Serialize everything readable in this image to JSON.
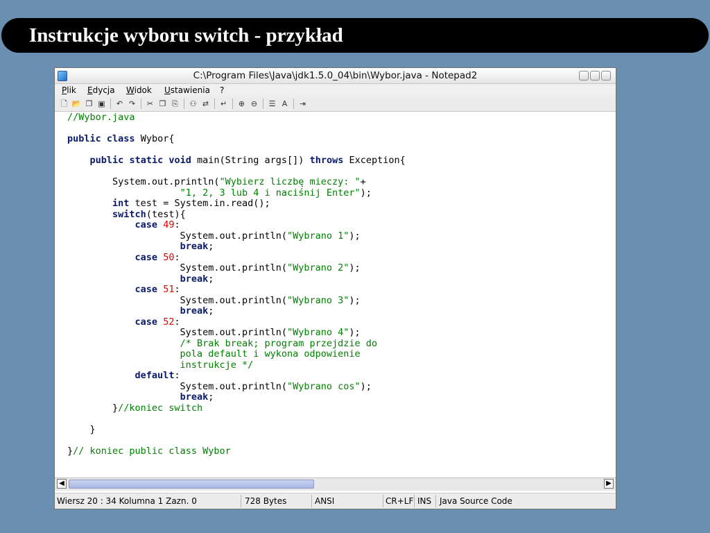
{
  "slide": {
    "title": "Instrukcje wyboru switch - przykład"
  },
  "window": {
    "caption": "C:\\Program Files\\Java\\jdk1.5.0_04\\bin\\Wybor.java - Notepad2"
  },
  "menu": {
    "items": [
      "Plik",
      "Edycja",
      "Widok",
      "Ustawienia",
      "?"
    ]
  },
  "toolbar": {
    "icons": [
      "new-file-icon",
      "open-file-icon",
      "browse-icon",
      "save-icon",
      "undo-icon",
      "redo-icon",
      "cut-icon",
      "copy-icon",
      "paste-icon",
      "find-icon",
      "replace-icon",
      "word-wrap-icon",
      "zoom-in-icon",
      "zoom-out-icon",
      "scheme-icon",
      "font-icon",
      "exit-icon"
    ]
  },
  "code": {
    "lines": [
      [
        {
          "t": "//Wybor.java",
          "c": "cmt"
        }
      ],
      [],
      [
        {
          "t": "public",
          "c": "kw"
        },
        {
          "t": " "
        },
        {
          "t": "class",
          "c": "kw"
        },
        {
          "t": " Wybor{"
        }
      ],
      [],
      [
        {
          "t": "    "
        },
        {
          "t": "public",
          "c": "kw"
        },
        {
          "t": " "
        },
        {
          "t": "static",
          "c": "kw"
        },
        {
          "t": " "
        },
        {
          "t": "void",
          "c": "kw"
        },
        {
          "t": " main(String args[]) "
        },
        {
          "t": "throws",
          "c": "kw"
        },
        {
          "t": " Exception{"
        }
      ],
      [],
      [
        {
          "t": "        System.out.println("
        },
        {
          "t": "\"Wybierz liczbę mieczy: \"",
          "c": "str"
        },
        {
          "t": "+"
        }
      ],
      [
        {
          "t": "                    "
        },
        {
          "t": "\"1, 2, 3 lub 4 i naciśnij Enter\"",
          "c": "str"
        },
        {
          "t": ");"
        }
      ],
      [
        {
          "t": "        "
        },
        {
          "t": "int",
          "c": "kw"
        },
        {
          "t": " test = System.in.read();"
        }
      ],
      [
        {
          "t": "        "
        },
        {
          "t": "switch",
          "c": "kw"
        },
        {
          "t": "(test){"
        }
      ],
      [
        {
          "t": "            "
        },
        {
          "t": "case",
          "c": "kw"
        },
        {
          "t": " "
        },
        {
          "t": "49",
          "c": "num"
        },
        {
          "t": ":"
        }
      ],
      [
        {
          "t": "                    System.out.println("
        },
        {
          "t": "\"Wybrano 1\"",
          "c": "str"
        },
        {
          "t": ");"
        }
      ],
      [
        {
          "t": "                    "
        },
        {
          "t": "break",
          "c": "kw"
        },
        {
          "t": ";"
        }
      ],
      [
        {
          "t": "            "
        },
        {
          "t": "case",
          "c": "kw"
        },
        {
          "t": " "
        },
        {
          "t": "50",
          "c": "num"
        },
        {
          "t": ":"
        }
      ],
      [
        {
          "t": "                    System.out.println("
        },
        {
          "t": "\"Wybrano 2\"",
          "c": "str"
        },
        {
          "t": ");"
        }
      ],
      [
        {
          "t": "                    "
        },
        {
          "t": "break",
          "c": "kw"
        },
        {
          "t": ";"
        }
      ],
      [
        {
          "t": "            "
        },
        {
          "t": "case",
          "c": "kw"
        },
        {
          "t": " "
        },
        {
          "t": "51",
          "c": "num"
        },
        {
          "t": ":"
        }
      ],
      [
        {
          "t": "                    System.out.println("
        },
        {
          "t": "\"Wybrano 3\"",
          "c": "str"
        },
        {
          "t": ");"
        }
      ],
      [
        {
          "t": "                    "
        },
        {
          "t": "break",
          "c": "kw"
        },
        {
          "t": ";"
        }
      ],
      [
        {
          "t": "            "
        },
        {
          "t": "case",
          "c": "kw"
        },
        {
          "t": " "
        },
        {
          "t": "52",
          "c": "num"
        },
        {
          "t": ":"
        }
      ],
      [
        {
          "t": "                    System.out.println("
        },
        {
          "t": "\"Wybrano 4\"",
          "c": "str"
        },
        {
          "t": ");"
        }
      ],
      [
        {
          "t": "                    "
        },
        {
          "t": "/* Brak break; program przejdzie do",
          "c": "cmt"
        }
      ],
      [
        {
          "t": "                    pola default i wykona odpowienie",
          "c": "cmt"
        }
      ],
      [
        {
          "t": "                    instrukcje */",
          "c": "cmt"
        }
      ],
      [
        {
          "t": "            "
        },
        {
          "t": "default",
          "c": "kw"
        },
        {
          "t": ":"
        }
      ],
      [
        {
          "t": "                    System.out.println("
        },
        {
          "t": "\"Wybrano cos\"",
          "c": "str"
        },
        {
          "t": ");"
        }
      ],
      [
        {
          "t": "                    "
        },
        {
          "t": "break",
          "c": "kw"
        },
        {
          "t": ";"
        }
      ],
      [
        {
          "t": "        }"
        },
        {
          "t": "//koniec switch",
          "c": "cmt"
        }
      ],
      [],
      [
        {
          "t": "    }"
        }
      ],
      [],
      [
        {
          "t": "}"
        },
        {
          "t": "// koniec public class Wybor",
          "c": "cmt"
        }
      ]
    ]
  },
  "status": {
    "position": "Wiersz 20 : 34   Kolumna 1   Zazn. 0",
    "size": "728 Bytes",
    "encoding": "ANSI",
    "line_endings": "CR+LF",
    "mode": "INS",
    "scheme": "Java Source Code"
  },
  "colors": {
    "background": "#6b8fb0",
    "keyword": "#0a1a6a",
    "string": "#008000",
    "number": "#e00000"
  }
}
